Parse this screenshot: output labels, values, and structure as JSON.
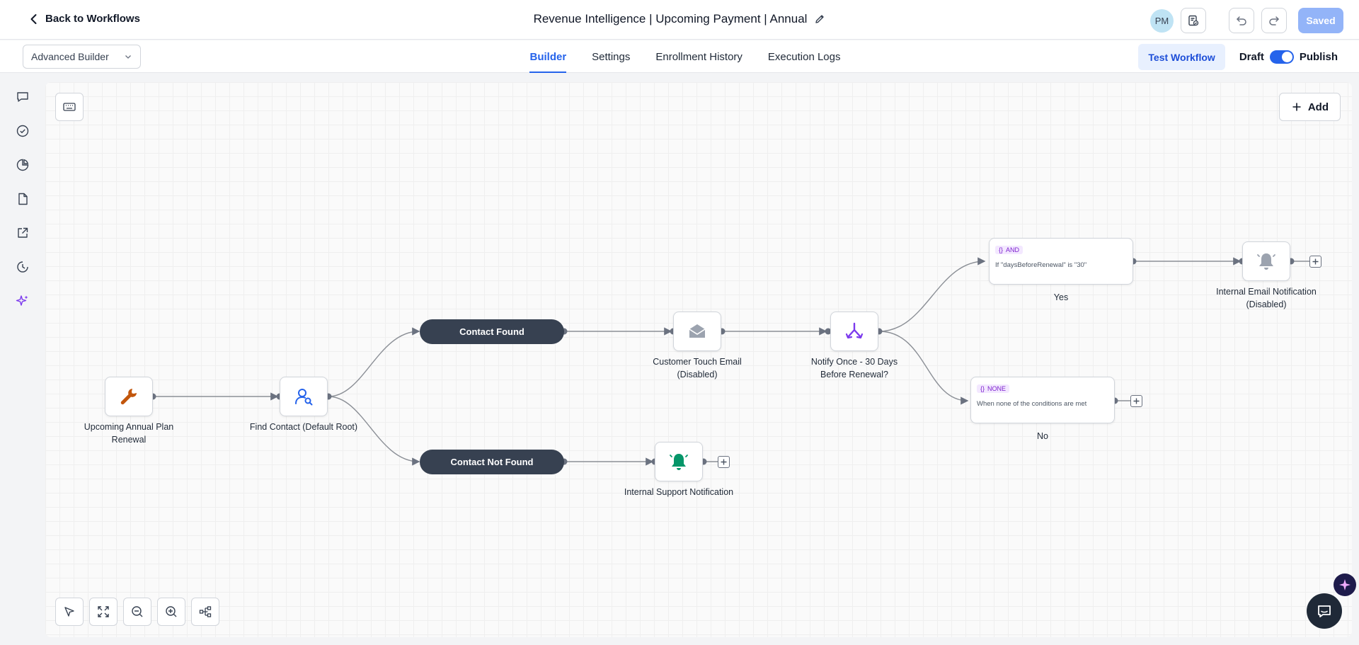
{
  "header": {
    "back_label": "Back to Workflows",
    "workflow_title": "Revenue Intelligence | Upcoming Payment | Annual",
    "avatar_initials": "PM",
    "saved_label": "Saved"
  },
  "subbar": {
    "builder_select_value": "Advanced Builder",
    "tabs": [
      {
        "label": "Builder",
        "active": true
      },
      {
        "label": "Settings",
        "active": false
      },
      {
        "label": "Enrollment History",
        "active": false
      },
      {
        "label": "Execution Logs",
        "active": false
      }
    ],
    "test_workflow_label": "Test Workflow",
    "draft_label": "Draft",
    "publish_label": "Publish",
    "publish_toggle_on": true
  },
  "left_rail": {
    "icons": [
      "chat-icon",
      "check-circle-icon",
      "pie-chart-icon",
      "document-icon",
      "external-link-icon",
      "history-icon",
      "sparkles-icon"
    ]
  },
  "canvas": {
    "add_label": "Add",
    "toolbar_icons": [
      "pointer-icon",
      "fit-screen-icon",
      "zoom-out-icon",
      "zoom-in-icon",
      "auto-layout-icon"
    ],
    "nodes": {
      "trigger": {
        "label": "Upcoming Annual Plan Renewal",
        "icon": "wrench-icon"
      },
      "find_contact": {
        "label": "Find Contact (Default Root)",
        "icon": "user-search-icon"
      },
      "contact_found": {
        "label": "Contact Found"
      },
      "contact_not_found": {
        "label": "Contact Not Found"
      },
      "customer_email": {
        "label": "Customer Touch Email (Disabled)",
        "icon": "mail-icon"
      },
      "internal_support": {
        "label": "Internal Support Notification",
        "icon": "bell-icon"
      },
      "notify_once": {
        "label": "Notify Once - 30 Days Before Renewal?",
        "icon": "branch-icon"
      },
      "cond_yes": {
        "tag": "AND",
        "text": "If \"daysBeforeRenewal\" is \"30\"",
        "branch_label": "Yes"
      },
      "cond_no": {
        "tag": "NONE",
        "text": "When none of the conditions are met",
        "branch_label": "No"
      },
      "internal_email": {
        "label": "Internal Email Notification (Disabled)",
        "icon": "bell-icon"
      }
    }
  },
  "colors": {
    "accent": "#2563eb",
    "saved_button": "#93b4f8",
    "pill": "#374151",
    "wrench": "#c2560c",
    "user_search": "#2563eb",
    "bell_active": "#059669",
    "branch": "#7c3aed",
    "disabled_icon": "#9ca3af"
  }
}
